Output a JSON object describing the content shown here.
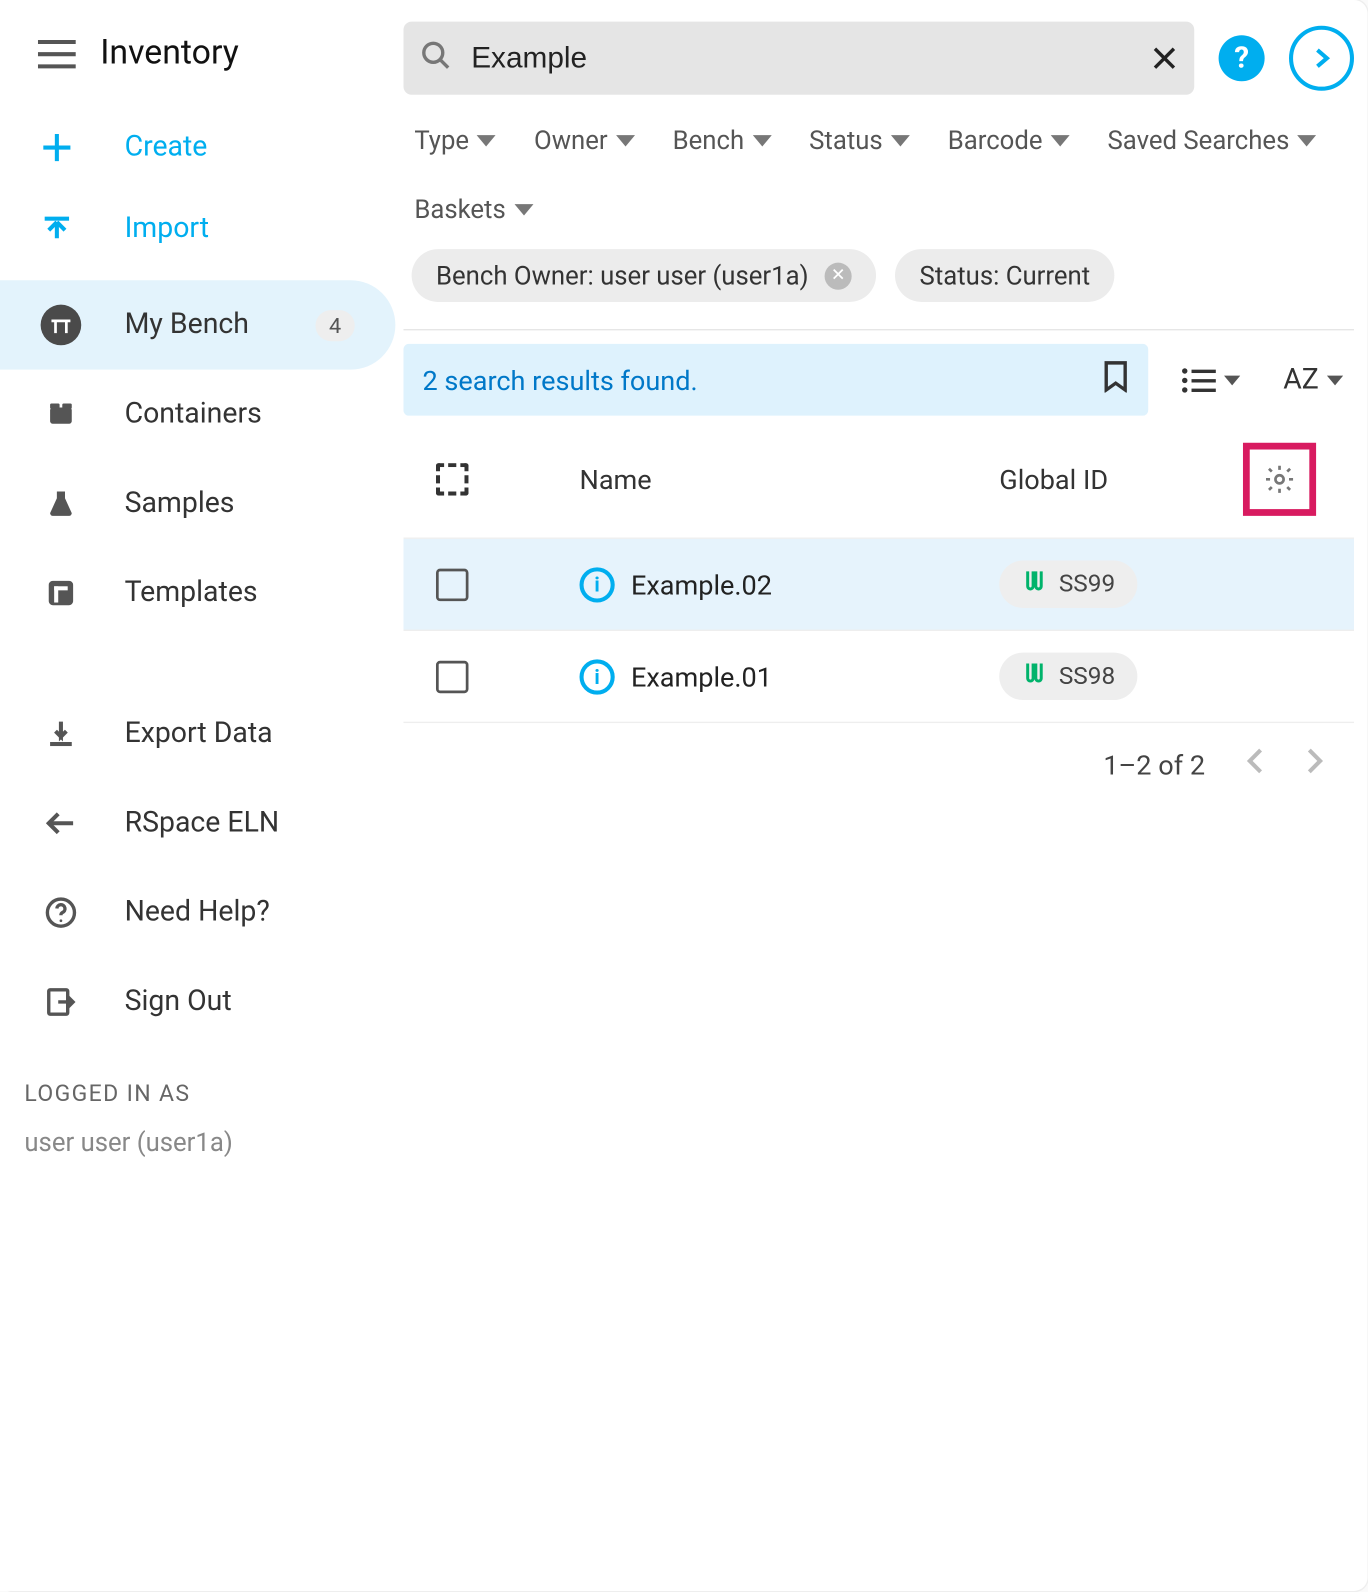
{
  "header": {
    "title": "Inventory"
  },
  "sidebar": {
    "actions": {
      "create": "Create",
      "import": "Import"
    },
    "items": [
      {
        "label": "My Bench",
        "badge": "4",
        "active": true
      },
      {
        "label": "Containers"
      },
      {
        "label": "Samples"
      },
      {
        "label": "Templates"
      }
    ],
    "links": [
      {
        "label": "Export Data"
      },
      {
        "label": "RSpace ELN"
      },
      {
        "label": "Need Help?"
      },
      {
        "label": "Sign Out"
      }
    ],
    "footer": {
      "label": "LOGGED IN AS",
      "user": "user user (user1a)"
    }
  },
  "search": {
    "value": "Example"
  },
  "filters": [
    "Type",
    "Owner",
    "Bench",
    "Status",
    "Barcode",
    "Saved Searches",
    "Baskets"
  ],
  "chips": [
    {
      "label": "Bench Owner: user user (user1a)",
      "removable": true
    },
    {
      "label": "Status: Current",
      "removable": false
    }
  ],
  "results": {
    "message": "2 search results found."
  },
  "sortIndicator": "AZ",
  "table": {
    "columns": {
      "name": "Name",
      "globalId": "Global ID"
    },
    "rows": [
      {
        "name": "Example.02",
        "id": "SS99",
        "selected": true
      },
      {
        "name": "Example.01",
        "id": "SS98",
        "selected": false
      }
    ]
  },
  "pager": {
    "range": "1–2 of 2"
  }
}
